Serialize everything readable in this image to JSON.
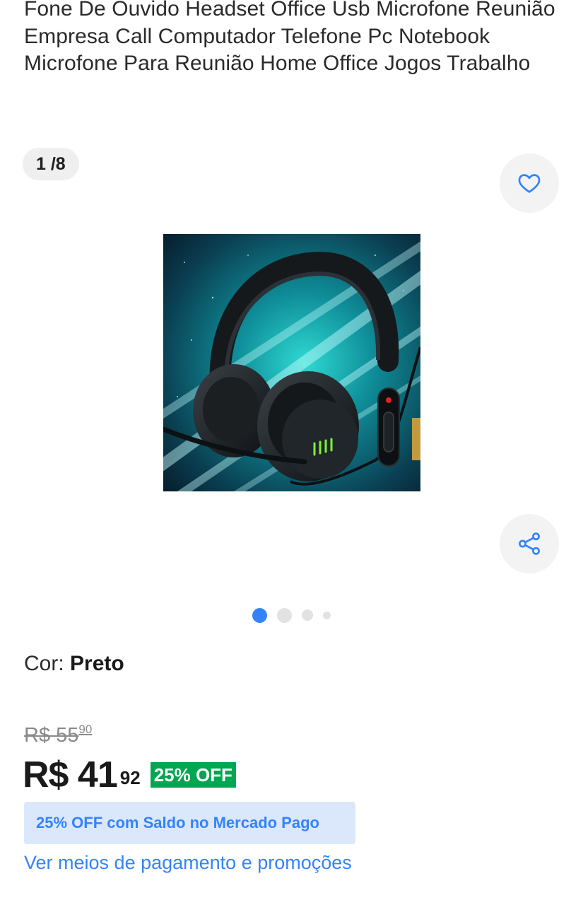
{
  "product": {
    "title": "Fone De Ouvido Headset Office Usb Microfone Reunião Empresa Call Computador Telefone Pc Notebook Microfone Para Reunião Home Office Jogos Trabalho"
  },
  "gallery": {
    "counter": "1 /8",
    "icons": {
      "favorite": "heart-icon",
      "share": "share-icon"
    },
    "dots_total": 4,
    "active_dot": 0
  },
  "variant": {
    "label": "Cor: ",
    "value": "Preto"
  },
  "pricing": {
    "original_integer": "R$ 55",
    "original_cents": "90",
    "current_integer": "R$ 41",
    "current_cents": "92",
    "discount_badge": "25% OFF",
    "promo_text": "25% OFF com Saldo no Mercado Pago",
    "payment_link": "Ver meios de pagamento e promoções"
  },
  "colors": {
    "accent_blue": "#3483fa",
    "discount_green": "#00a650",
    "promo_bg": "#dbe8fb"
  }
}
